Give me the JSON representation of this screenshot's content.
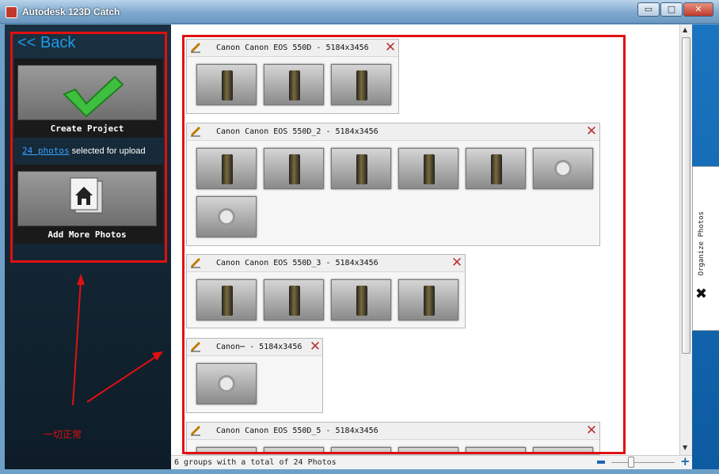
{
  "window": {
    "title": "Autodesk 123D Catch",
    "minimize": "▭",
    "maximize": "□",
    "close": "✕"
  },
  "sidebar": {
    "back_label": "<< Back",
    "create_label": "Create Project",
    "upload_link": "24 photos",
    "upload_text": " selected for upload",
    "add_label": "Add More Photos"
  },
  "annotation": {
    "text": "一切正常"
  },
  "groups": [
    {
      "name": "Canon Canon EOS 550D - 5184x3456",
      "photos": 3
    },
    {
      "name": "Canon Canon EOS 550D_2 - 5184x3456",
      "photos": 7
    },
    {
      "name": "Canon Canon EOS 550D_3 - 5184x3456",
      "photos": 4
    },
    {
      "name": "Canon⋯ - 5184x3456",
      "photos": 1
    },
    {
      "name": "Canon Canon EOS 550D_5 - 5184x3456",
      "photos": 6
    }
  ],
  "right_panel": {
    "tab_label": "Organize Photos"
  },
  "status": {
    "text": "6 groups with a total of 24 Photos"
  },
  "colors": {
    "accent": "#1e9be8",
    "annotation_red": "#e01010",
    "panel_blue": "#1b74c0"
  }
}
